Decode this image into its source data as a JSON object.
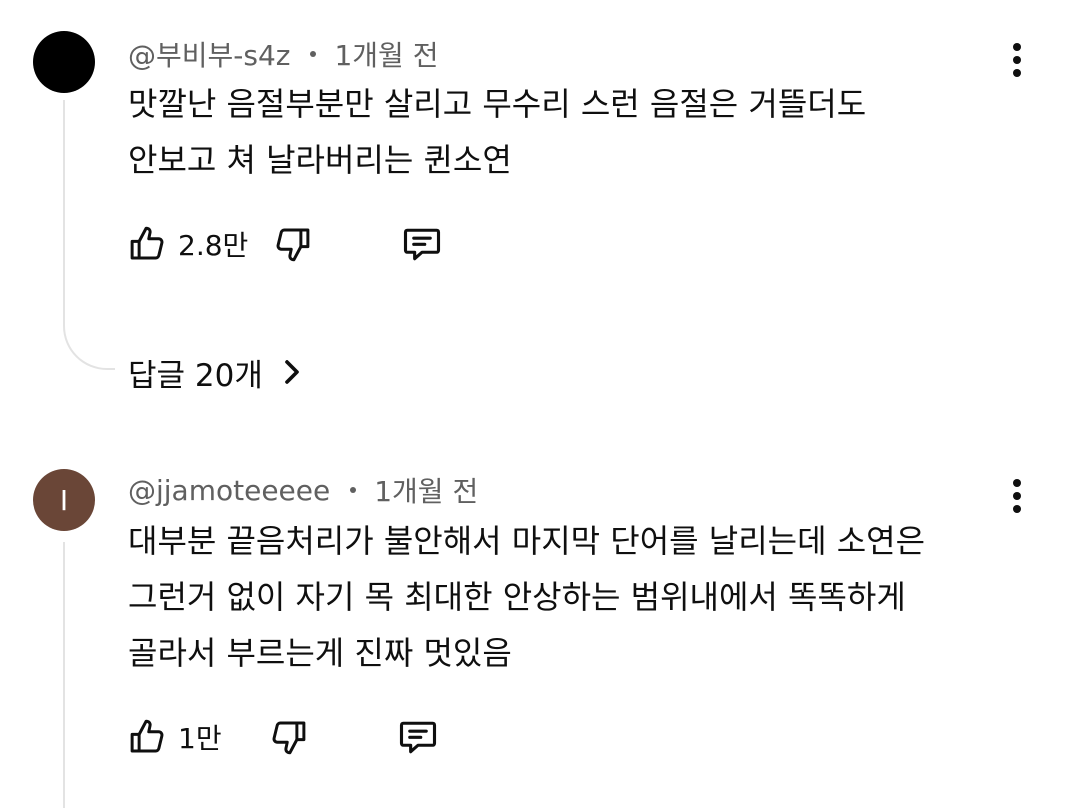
{
  "comments": [
    {
      "avatar_letter": "",
      "avatar_color": "#000000",
      "author": "@부비부-s4z",
      "time": "1개월 전",
      "lines": [
        "맛깔난 음절부분만 살리고 무수리 스런 음절은 거뜰더도",
        "안보고 쳐 날라버리는 퀸소연"
      ],
      "likes": "2.8만",
      "replies_label": "답글 20개"
    },
    {
      "avatar_letter": "I",
      "avatar_color": "#6a4637",
      "author": "@jjamoteeeee",
      "time": "1개월 전",
      "lines": [
        "대부분 끝음처리가 불안해서 마지막 단어를 날리는데 소연은",
        "그런거 없이 자기 목 최대한 안상하는 범위내에서 똑똑하게",
        "골라서 부르는게 진짜 멋있음"
      ],
      "likes": "1만"
    }
  ],
  "icons": {
    "like": "thumbs-up-icon",
    "dislike": "thumbs-down-icon",
    "reply": "comment-icon",
    "more": "more-vertical-icon",
    "expand": "chevron-right-icon"
  }
}
